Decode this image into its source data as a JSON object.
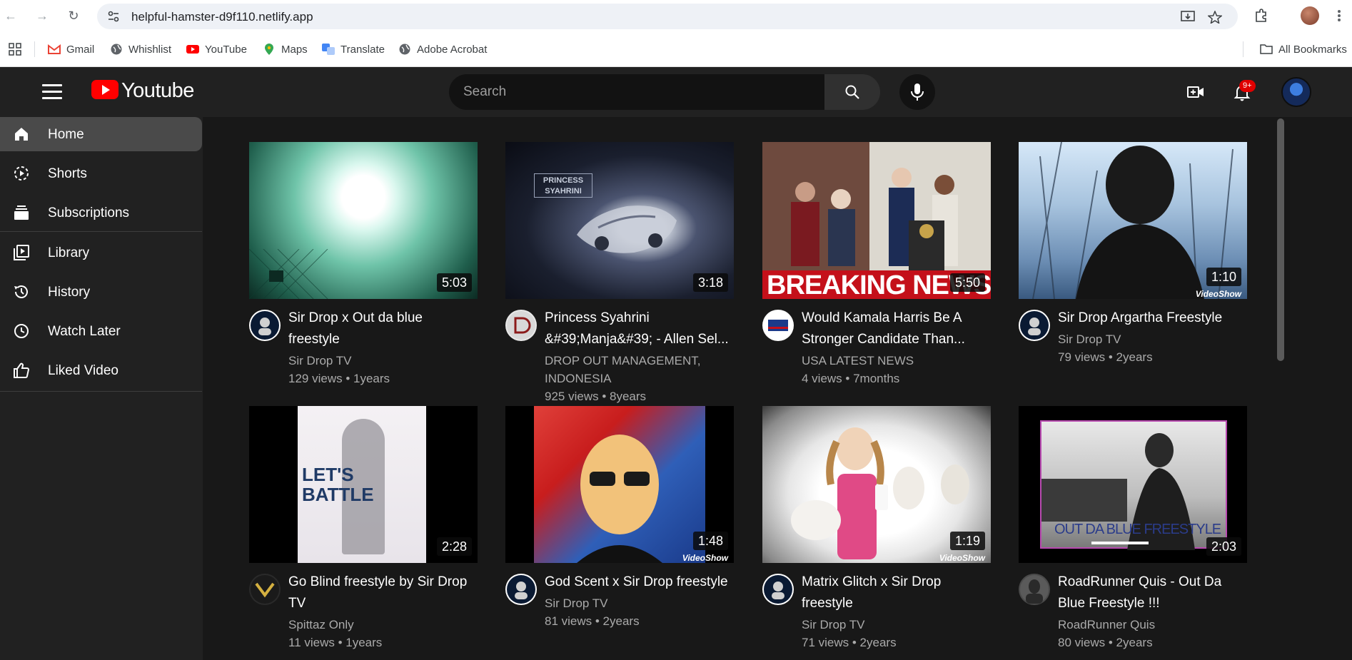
{
  "browser": {
    "url": "helpful-hamster-d9f110.netlify.app",
    "bookmarks": [
      {
        "label": "Gmail",
        "icon": "gmail-icon"
      },
      {
        "label": "Whishlist",
        "icon": "globe-icon"
      },
      {
        "label": "YouTube",
        "icon": "youtube-icon"
      },
      {
        "label": "Maps",
        "icon": "maps-icon"
      },
      {
        "label": "Translate",
        "icon": "translate-icon"
      },
      {
        "label": "Adobe Acrobat",
        "icon": "globe-icon"
      }
    ],
    "all_bookmarks": "All Bookmarks"
  },
  "header": {
    "app_title": "Youtube",
    "search_placeholder": "Search",
    "notification_count": "9+"
  },
  "sidebar": {
    "items": [
      {
        "label": "Home",
        "icon": "home-icon",
        "active": true
      },
      {
        "label": "Shorts",
        "icon": "shorts-icon"
      },
      {
        "label": "Subscriptions",
        "icon": "subscriptions-icon"
      },
      {
        "label": "Library",
        "icon": "library-icon"
      },
      {
        "label": "History",
        "icon": "history-icon"
      },
      {
        "label": "Watch Later",
        "icon": "clock-icon"
      },
      {
        "label": "Liked Video",
        "icon": "thumbs-up-icon"
      }
    ]
  },
  "videos": [
    {
      "title": "Sir Drop x Out da blue freestyle",
      "channel": "Sir Drop TV",
      "stats": "129 views • 1years",
      "duration": "5:03"
    },
    {
      "title": "Princess Syahrini &#39;Manja&#39; - Allen Sel...",
      "channel": "DROP OUT MANAGEMENT, INDONESIA",
      "stats": "925 views • 8years",
      "duration": "3:18"
    },
    {
      "title": "Would Kamala Harris Be A Stronger Candidate Than...",
      "channel": "USA LATEST NEWS",
      "stats": "4 views • 7months",
      "duration": "5:50",
      "overlay": "BREAKING NEWS"
    },
    {
      "title": "Sir Drop Argartha Freestyle",
      "channel": "Sir Drop TV",
      "stats": "79 views • 2years",
      "duration": "1:10"
    },
    {
      "title": "Go Blind freestyle by Sir Drop TV",
      "channel": "Spittaz Only",
      "stats": "11 views • 1years",
      "duration": "2:28"
    },
    {
      "title": "God Scent x Sir Drop freestyle",
      "channel": "Sir Drop TV",
      "stats": "81 views • 2years",
      "duration": "1:48"
    },
    {
      "title": "Matrix Glitch x Sir Drop freestyle",
      "channel": "Sir Drop TV",
      "stats": "71 views • 2years",
      "duration": "1:19"
    },
    {
      "title": "RoadRunner Quis - Out Da Blue Freestyle !!!",
      "channel": "RoadRunner Quis",
      "stats": "80 views • 2years",
      "duration": "2:03"
    }
  ],
  "thumbnail_text": {
    "princess": "PRINCESS SYAHRINI",
    "lets_battle": "LET'S BATTLE",
    "out_da_blue": "OUT DA BLUE FREESTYLE",
    "videoshow": "VideoShow"
  }
}
